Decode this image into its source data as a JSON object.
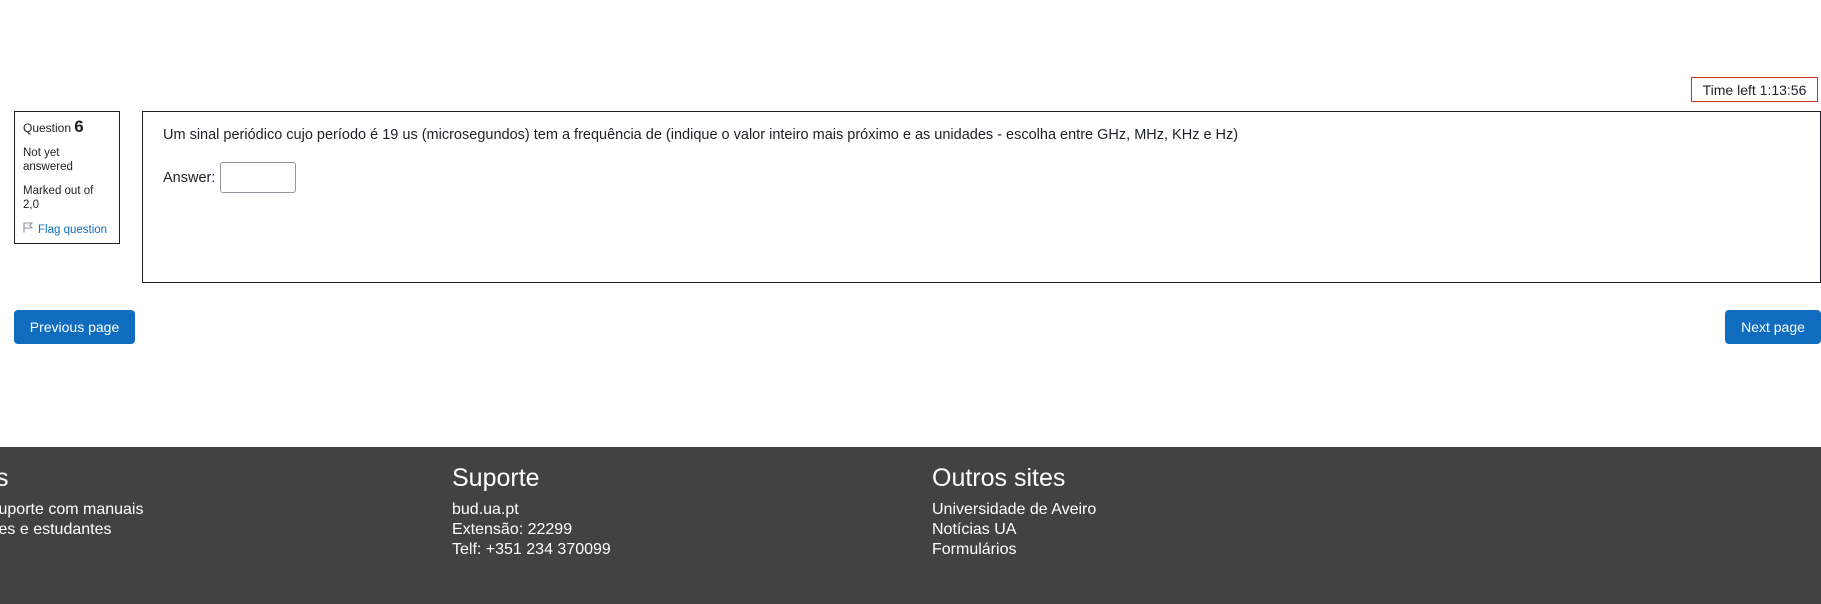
{
  "timer": {
    "label": "Time left 1:13:56"
  },
  "question_info": {
    "label": "Question",
    "number": "6",
    "state": "Not yet answered",
    "grade": "Marked out of 2,0",
    "flag_label": "Flag question"
  },
  "question": {
    "text": "Um sinal periódico cujo período é 19 us (microsegundos) tem a frequência de (indique o valor inteiro mais próximo e as unidades - escolha entre GHz, MHz, KHz e Hz)",
    "answer_label": "Answer:",
    "answer_value": ""
  },
  "navigation": {
    "previous_label": "Previous page",
    "next_label": "Next page"
  },
  "footer": {
    "col1": {
      "title": "Manuais",
      "lines": [
        "Página de suporte com manuais",
        "para docentes e estudantes"
      ]
    },
    "col2": {
      "title": "Suporte",
      "lines": [
        "bud.ua.pt",
        "Extensão: 22299",
        "Telf: +351 234 370099"
      ]
    },
    "col3": {
      "title": "Outros sites",
      "lines": [
        "Universidade de Aveiro",
        "Notícias UA",
        "Formulários"
      ]
    }
  },
  "colors": {
    "primary": "#0f6cbf",
    "footer_bg": "#424242",
    "timer_border": "#ca3120"
  }
}
